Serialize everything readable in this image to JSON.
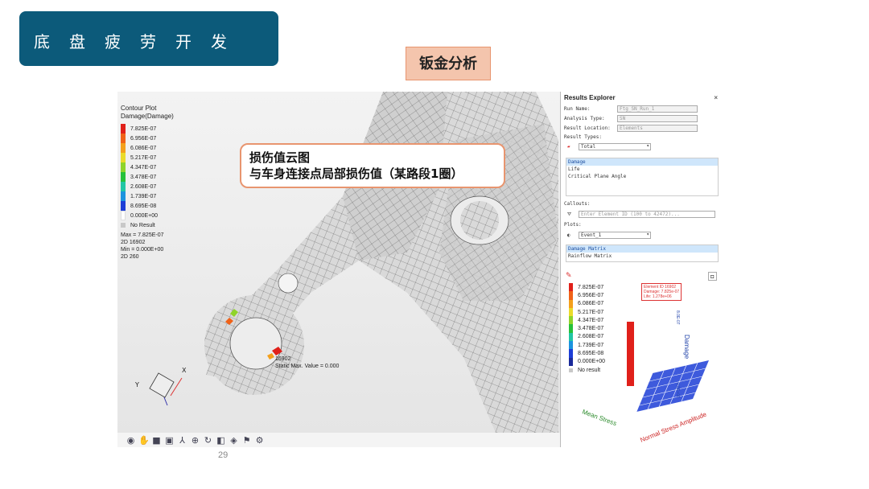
{
  "slide": {
    "title": "底盘疲劳开发",
    "tag": "钣金分析",
    "page_number": "29"
  },
  "callout": {
    "line1": "损伤值云图",
    "line2": "与车身连接点局部损伤值（某路段1圈）"
  },
  "contour": {
    "title_line1": "Contour Plot",
    "title_line2": "Damage(Damage)",
    "levels": [
      {
        "label": "7.825E-07",
        "color": "#e0201a"
      },
      {
        "label": "6.956E-07",
        "color": "#f06218"
      },
      {
        "label": "6.086E-07",
        "color": "#f4a01c"
      },
      {
        "label": "5.217E-07",
        "color": "#eadb2a"
      },
      {
        "label": "4.347E-07",
        "color": "#8fd42a"
      },
      {
        "label": "3.478E-07",
        "color": "#26c13a"
      },
      {
        "label": "2.608E-07",
        "color": "#21c6a4"
      },
      {
        "label": "1.739E-07",
        "color": "#1b93de"
      },
      {
        "label": "8.695E-08",
        "color": "#1c3dd6"
      },
      {
        "label": "0.000E+00",
        "color": "#ffffff"
      },
      {
        "label": "No Result",
        "color": "#c8c8c8"
      }
    ],
    "max_line": "Max = 7.825E-07",
    "max_elem": "2D 16902",
    "min_line": "Min = 0.000E+00",
    "min_elem": "2D 260"
  },
  "viewport": {
    "element_id": "16902",
    "static_max": "Static Max. Value = 0.000",
    "axis_x": "X",
    "axis_y": "Y"
  },
  "toolbar": {
    "icons": [
      "eye-icon",
      "hand-icon",
      "cube-icon",
      "palette-icon",
      "axis-icon",
      "zoom-icon",
      "rotate-icon",
      "view-icon",
      "layers-icon",
      "flag-icon",
      "settings-icon"
    ]
  },
  "results_explorer": {
    "title": "Results Explorer",
    "close": "×",
    "run_name_label": "Run Name:",
    "run_name_value": "Ftg_SN_Run_1",
    "analysis_type_label": "Analysis Type:",
    "analysis_type_value": "SN",
    "result_location_label": "Result Location:",
    "result_location_value": "Elements",
    "result_types_label": "Result Types:",
    "result_type_selected": "Total",
    "result_list": [
      "Damage",
      "Life",
      "Critical Plane Angle"
    ],
    "callouts_label": "Callouts:",
    "callouts_placeholder": "Enter Element ID (100 to 42472)...",
    "plots_label": "Plots:",
    "plots_selected": "Event_1",
    "plots_list": [
      "Damage Matrix",
      "Rainflow Matrix"
    ]
  },
  "damage_chart": {
    "levels": [
      "7.825E-07",
      "6.956E-07",
      "6.086E-07",
      "5.217E-07",
      "4.347E-07",
      "3.478E-07",
      "2.608E-07",
      "1.739E-07",
      "8.695E-08",
      "0.000E+00",
      "No result"
    ],
    "note_line1": "Element ID 16902",
    "note_line2": "Damage: 7.825e-07",
    "note_line3": "Life: 1.278e+06",
    "axis_z": "Damage",
    "axis_x": "Mean Stress",
    "axis_y": "Normal Stress Amplitude",
    "tick_top": "8.0E-07",
    "tick_bottom": "0.0E+00"
  }
}
